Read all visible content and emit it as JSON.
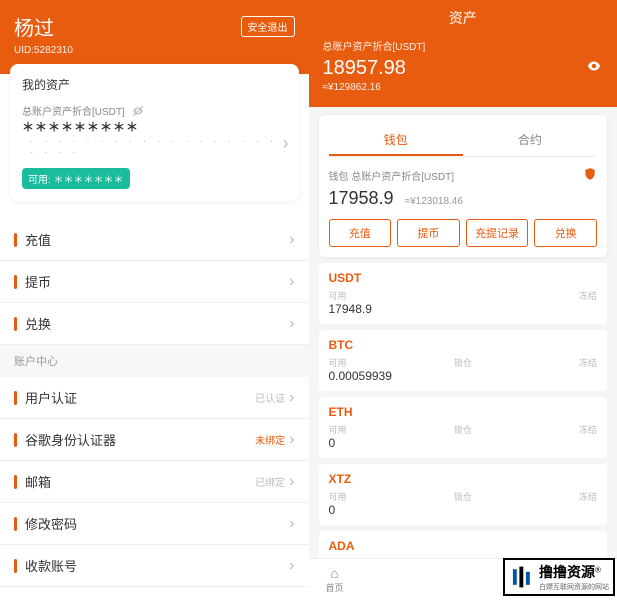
{
  "left": {
    "user_name": "杨过",
    "logout": "安全退出",
    "uid_label": "UID:5282310",
    "assets_card": {
      "title": "我的资产",
      "label": "总账户资产折合[USDT]",
      "masked": "＊＊＊＊＊＊＊＊＊",
      "dots": "· · · · · · · · · · · · · · · · · · · · · ·",
      "available": "可用: ＊＊＊＊＊＊＊"
    },
    "menu": {
      "recharge": "充值",
      "withdraw": "提币",
      "exchange": "兑换"
    },
    "section": "账户中心",
    "account_menu": {
      "auth": "用户认证",
      "auth_status": "已认证",
      "google": "谷歌身份认证器",
      "google_status": "未绑定",
      "email": "邮箱",
      "email_status": "已绑定",
      "password": "修改密码",
      "receive": "收款账号"
    }
  },
  "right": {
    "title": "资产",
    "total_label": "总账户资产折合[USDT]",
    "total_amount": "18957.98",
    "total_approx": "≈¥129862.16",
    "tabs": {
      "wallet": "钱包",
      "contract": "合约"
    },
    "wallet": {
      "label": "钱包 总账户资产折合[USDT]",
      "amount": "17958.9",
      "approx": "≈¥123018.46",
      "actions": {
        "recharge": "充值",
        "withdraw": "提币",
        "records": "充提记录",
        "exchange": "兑换"
      }
    },
    "cols": {
      "available": "可用",
      "locked": "锁仓",
      "frozen": "冻结"
    },
    "coins": [
      {
        "sym": "USDT",
        "available": "17948.9",
        "locked": "",
        "frozen": "冻结"
      },
      {
        "sym": "BTC",
        "available": "0.00059939",
        "locked": "锁仓",
        "frozen": "冻结"
      },
      {
        "sym": "ETH",
        "available": "0",
        "locked": "锁仓",
        "frozen": "冻结"
      },
      {
        "sym": "XTZ",
        "available": "0",
        "locked": "锁仓",
        "frozen": "冻结"
      },
      {
        "sym": "ADA",
        "available": "",
        "locked": "",
        "frozen": ""
      }
    ],
    "nav": {
      "home": "首页"
    }
  },
  "watermark": {
    "main": "撸撸资源",
    "sub": "白嫖互联网资源的网站"
  },
  "col_avail": "可用"
}
